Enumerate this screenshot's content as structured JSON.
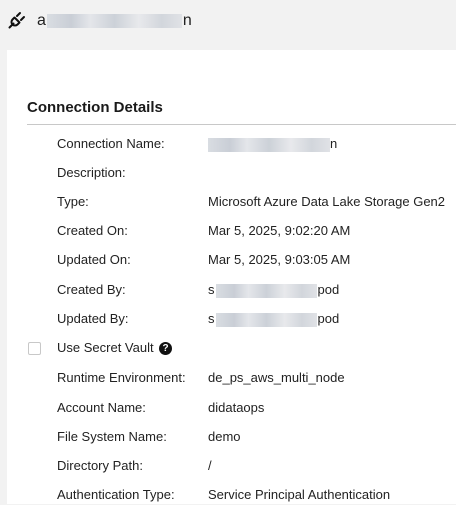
{
  "header": {
    "title_visible_start": "a",
    "title_visible_end": "n",
    "icon": "plug-icon"
  },
  "section": {
    "title": "Connection Details"
  },
  "fields": {
    "connection_name": {
      "label": "Connection Name:",
      "value_end": "n"
    },
    "description": {
      "label": "Description:",
      "value": ""
    },
    "type": {
      "label": "Type:",
      "value": "Microsoft Azure Data Lake Storage Gen2"
    },
    "created_on": {
      "label": "Created On:",
      "value": "Mar 5, 2025, 9:02:20 AM"
    },
    "updated_on": {
      "label": "Updated On:",
      "value": "Mar 5, 2025, 9:03:05 AM"
    },
    "created_by": {
      "label": "Created By:",
      "value_start": "s",
      "value_end": "pod"
    },
    "updated_by": {
      "label": "Updated By:",
      "value_start": "s",
      "value_end": "pod"
    },
    "use_secret_vault": {
      "label": "Use Secret Vault",
      "checked": false,
      "help_icon": "question-icon",
      "help_glyph": "?"
    },
    "runtime_environment": {
      "label": "Runtime Environment:",
      "value": "de_ps_aws_multi_node"
    },
    "account_name": {
      "label": "Account Name:",
      "value": "didataops"
    },
    "file_system_name": {
      "label": "File System Name:",
      "value": "demo"
    },
    "directory_path": {
      "label": "Directory Path:",
      "value": "/"
    },
    "authentication_type": {
      "label": "Authentication Type:",
      "value": "Service Principal Authentication"
    }
  }
}
